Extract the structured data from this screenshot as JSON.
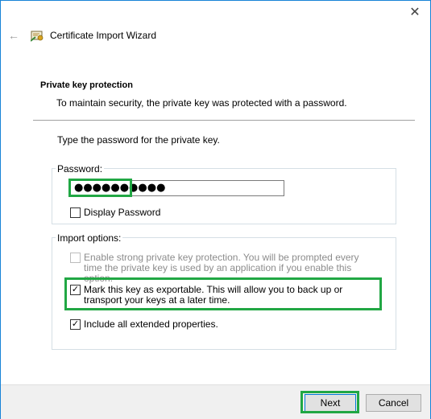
{
  "window": {
    "title": "Certificate Import Wizard",
    "close_glyph": "✕",
    "back_glyph": "←",
    "accent_color": "#1883d7"
  },
  "page": {
    "section_title": "Private key protection",
    "section_description": "To maintain security, the private key was protected with a password.",
    "prompt": "Type the password for the private key."
  },
  "password_group": {
    "label": "Password:",
    "value": "●●●●●●●●●●",
    "display_password_label": "Display Password",
    "display_password_checked": false
  },
  "import_options": {
    "label": "Import options:",
    "items": [
      {
        "label": "Enable strong private key protection. You will be prompted every time the private key is used by an application if you enable this option.",
        "checked": false,
        "enabled": false
      },
      {
        "label": "Mark this key as exportable. This will allow you to back up or transport your keys at a later time.",
        "checked": true,
        "enabled": true
      },
      {
        "label": "Include all extended properties.",
        "checked": true,
        "enabled": true
      }
    ]
  },
  "footer": {
    "next_label": "Next",
    "cancel_label": "Cancel"
  },
  "highlight_color": "#21a744",
  "check_glyph": "✓",
  "icons": [
    "close-icon",
    "back-arrow-icon",
    "certificate-wizard-icon",
    "checkmark-icon"
  ]
}
